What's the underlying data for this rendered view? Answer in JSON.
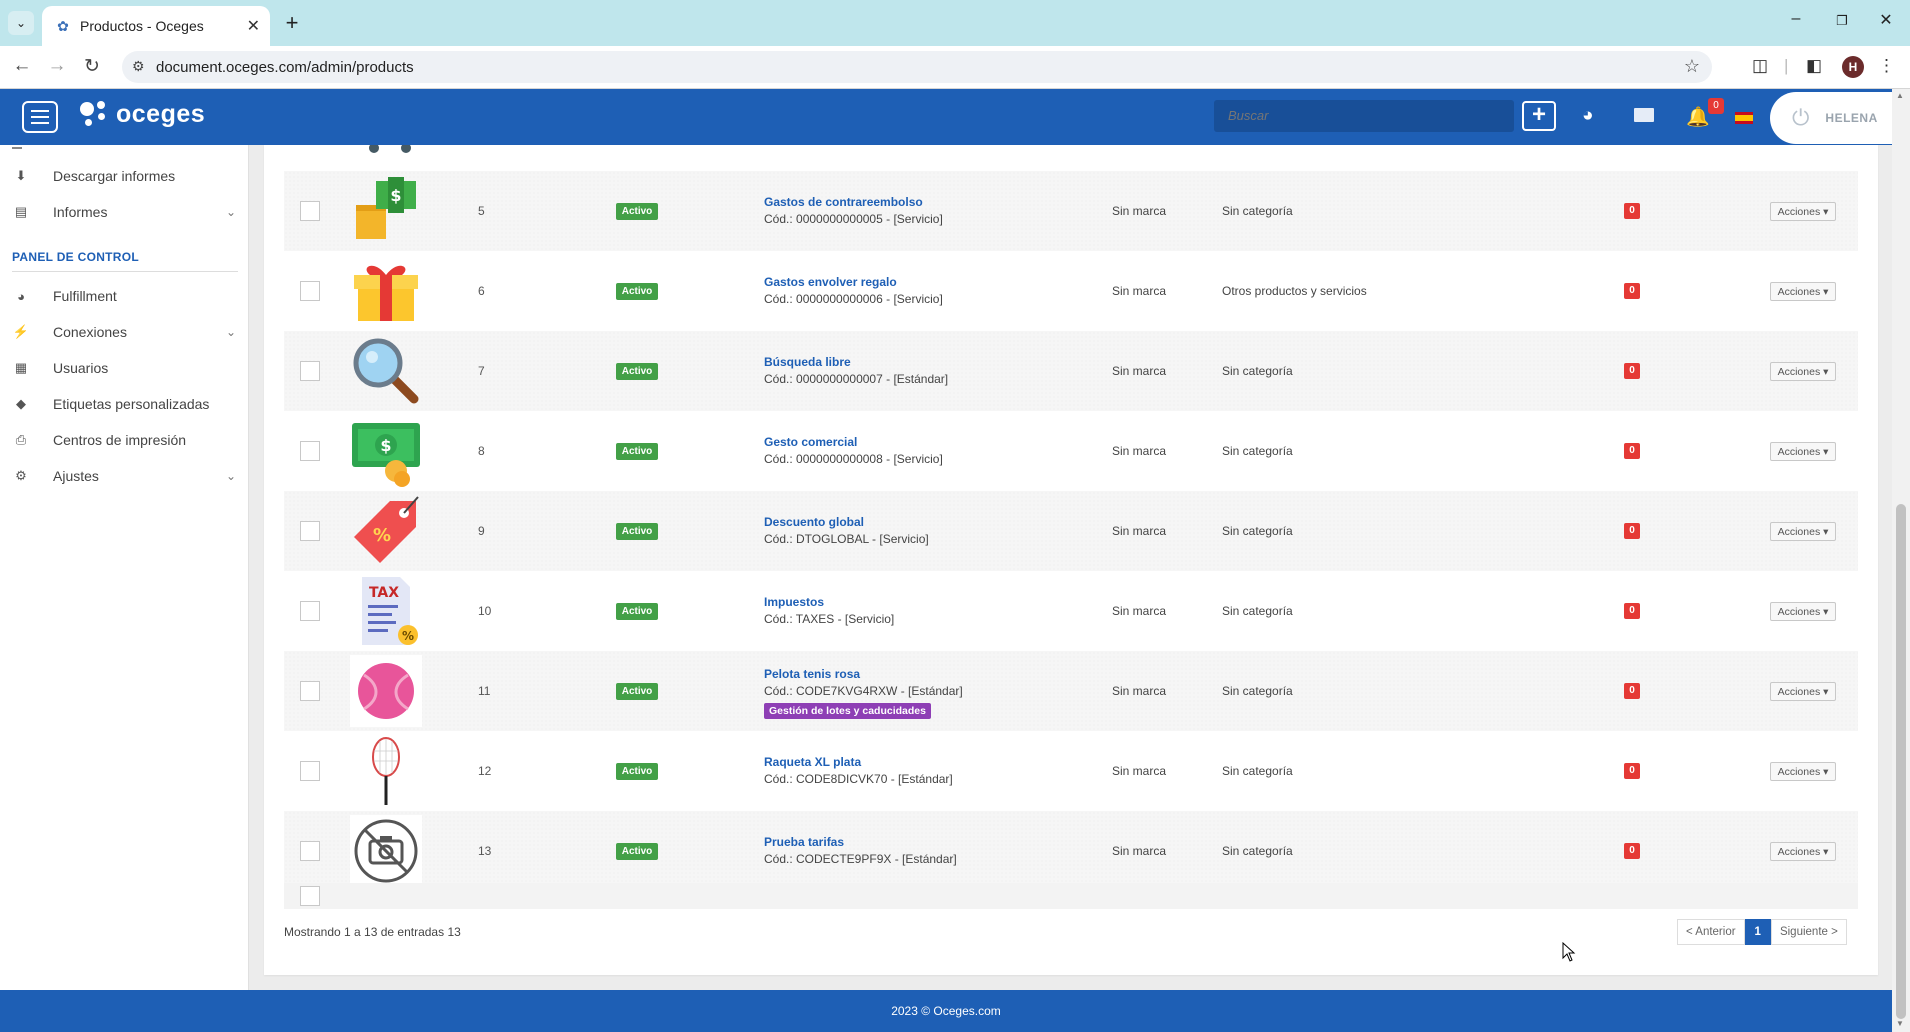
{
  "browser": {
    "tab_title": "Productos - Oceges",
    "url": "document.oceges.com/admin/products",
    "profile_initial": "H"
  },
  "header": {
    "logo_text": "oceges",
    "search_placeholder": "Buscar",
    "notification_count": "0",
    "user_name": "HELENA"
  },
  "sidebar": {
    "items_top": [
      {
        "label": "Descargar informes",
        "icon": "download-icon"
      },
      {
        "label": "Informes",
        "icon": "bar-chart-icon",
        "expandable": true
      }
    ],
    "section_title": "PANEL DE CONTROL",
    "items": [
      {
        "label": "Fulfillment",
        "icon": "dashboard-icon"
      },
      {
        "label": "Conexiones",
        "icon": "plug-icon",
        "expandable": true
      },
      {
        "label": "Usuarios",
        "icon": "user-badge-icon"
      },
      {
        "label": "Etiquetas personalizadas",
        "icon": "tag-icon"
      },
      {
        "label": "Centros de impresión",
        "icon": "printer-icon"
      },
      {
        "label": "Ajustes",
        "icon": "cogs-icon",
        "expandable": true
      }
    ]
  },
  "products": [
    {
      "id": "5",
      "status": "Activo",
      "name": "Gastos de contrareembolso",
      "code": "Cód.: 0000000000005 - [Servicio]",
      "brand": "Sin marca",
      "category": "Sin categoría",
      "stock": "0",
      "actions": "Acciones",
      "image": "cash-box-icon"
    },
    {
      "id": "6",
      "status": "Activo",
      "name": "Gastos envolver regalo",
      "code": "Cód.: 0000000000006 - [Servicio]",
      "brand": "Sin marca",
      "category": "Otros productos y servicios",
      "stock": "0",
      "actions": "Acciones",
      "image": "gift-icon"
    },
    {
      "id": "7",
      "status": "Activo",
      "name": "Búsqueda libre",
      "code": "Cód.: 0000000000007 - [Estándar]",
      "brand": "Sin marca",
      "category": "Sin categoría",
      "stock": "0",
      "actions": "Acciones",
      "image": "magnifier-icon"
    },
    {
      "id": "8",
      "status": "Activo",
      "name": "Gesto comercial",
      "code": "Cód.: 0000000000008 - [Servicio]",
      "brand": "Sin marca",
      "category": "Sin categoría",
      "stock": "0",
      "actions": "Acciones",
      "image": "money-coins-icon"
    },
    {
      "id": "9",
      "status": "Activo",
      "name": "Descuento global",
      "code": "Cód.: DTOGLOBAL - [Servicio]",
      "brand": "Sin marca",
      "category": "Sin categoría",
      "stock": "0",
      "actions": "Acciones",
      "image": "discount-tag-icon"
    },
    {
      "id": "10",
      "status": "Activo",
      "name": "Impuestos",
      "code": "Cód.: TAXES - [Servicio]",
      "brand": "Sin marca",
      "category": "Sin categoría",
      "stock": "0",
      "actions": "Acciones",
      "image": "tax-document-icon",
      "image_text": "TAX"
    },
    {
      "id": "11",
      "status": "Activo",
      "name": "Pelota tenis rosa",
      "code": "Cód.: CODE7KVG4RXW - [Estándar]",
      "tag": "Gestión de lotes y caducidades",
      "brand": "Sin marca",
      "category": "Sin categoría",
      "stock": "0",
      "actions": "Acciones",
      "image": "tennis-ball-icon"
    },
    {
      "id": "12",
      "status": "Activo",
      "name": "Raqueta XL plata",
      "code": "Cód.: CODE8DICVK70 - [Estándar]",
      "brand": "Sin marca",
      "category": "Sin categoría",
      "stock": "0",
      "actions": "Acciones",
      "image": "racket-icon"
    },
    {
      "id": "13",
      "status": "Activo",
      "name": "Prueba tarifas",
      "code": "Cód.: CODECTE9PF9X - [Estándar]",
      "brand": "Sin marca",
      "category": "Sin categoría",
      "stock": "0",
      "actions": "Acciones",
      "image": "no-photo-icon"
    }
  ],
  "table_footer": {
    "summary": "Mostrando 1 a 13 de entradas 13",
    "prev": "< Anterior",
    "current_page": "1",
    "next": "Siguiente >"
  },
  "footer": {
    "text": "2023 © Oceges.com"
  },
  "colors": {
    "brand_blue": "#1e5fb5",
    "active_green": "#43a047",
    "stock_red": "#e53935",
    "tag_purple": "#8e3fb5"
  }
}
